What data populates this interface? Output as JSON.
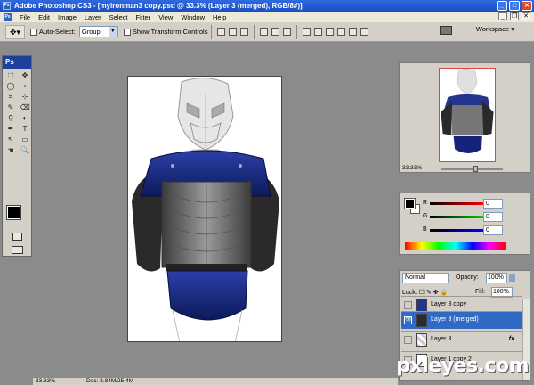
{
  "window": {
    "title": "Adobe Photoshop CS3 - [myironman3 copy.psd @ 33.3% (Layer 3 (merged), RGB/8#)]",
    "buttons": [
      "minimize",
      "maximize",
      "close"
    ]
  },
  "menubar": {
    "items": [
      "File",
      "Edit",
      "Image",
      "Layer",
      "Select",
      "Filter",
      "View",
      "Window",
      "Help"
    ]
  },
  "options_bar": {
    "auto_select_label": "Auto-Select:",
    "auto_select_value": "Group",
    "show_transform_label": "Show Transform Controls",
    "workspace_label": "Workspace ▾"
  },
  "toolbox": {
    "logo": "Ps",
    "tools": [
      "⬚",
      "✥",
      "◯",
      "⌖",
      "⌗",
      "⊹",
      "✎",
      "⌫",
      "⚲",
      "◐",
      "✒",
      "T",
      "↖",
      "▭",
      "☚",
      "🔍"
    ]
  },
  "navigator": {
    "zoom": "33.33%"
  },
  "color_panel": {
    "channels": [
      {
        "label": "R",
        "value": "0",
        "color": "#d11"
      },
      {
        "label": "G",
        "value": "0",
        "color": "#1a1"
      },
      {
        "label": "B",
        "value": "0",
        "color": "#12c"
      }
    ]
  },
  "layers_panel": {
    "blend_mode": "Normal",
    "opacity_label": "Opacity:",
    "opacity_value": "100%",
    "lock_label": "Lock:",
    "fill_label": "Fill:",
    "fill_value": "100%",
    "layers": [
      {
        "name": "Layer 3 copy",
        "visible": false,
        "active": false,
        "fx": ""
      },
      {
        "name": "Layer 3 (merged)",
        "visible": true,
        "active": true,
        "fx": ""
      },
      {
        "name": "Layer 3",
        "visible": false,
        "active": false,
        "fx": "fx"
      },
      {
        "name": "Layer 1 copy 2",
        "visible": false,
        "active": false,
        "fx": ""
      }
    ]
  },
  "statusbar": {
    "zoom": "33.33%",
    "doc": "Doc: 3.84M/25.4M"
  },
  "watermark": "pxleyes.com"
}
